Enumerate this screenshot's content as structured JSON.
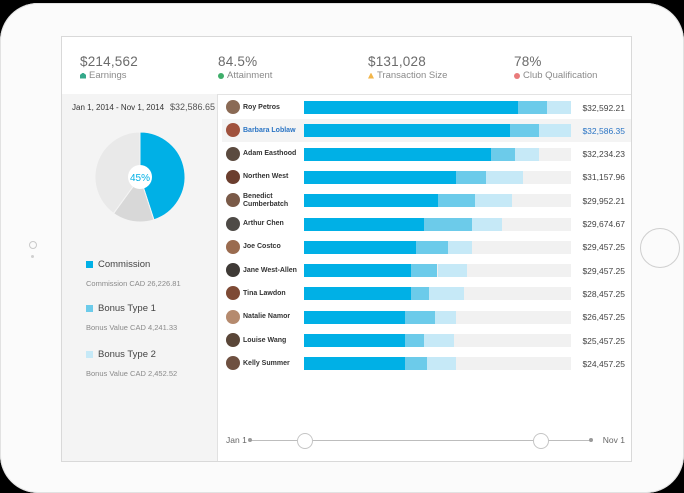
{
  "kpis": [
    {
      "value": "$214,562",
      "label": "Earnings",
      "icon": "earnings-icon",
      "color": "#34a88a"
    },
    {
      "value": "84.5%",
      "label": "Attainment",
      "icon": "attainment-icon",
      "color": "#3fae6a"
    },
    {
      "value": "$131,028",
      "label": "Transaction Size",
      "icon": "transaction-icon",
      "color": "#f2b64a"
    },
    {
      "value": "78%",
      "label": "Club Qualification",
      "icon": "club-icon",
      "color": "#e97b7b"
    }
  ],
  "left": {
    "date_range": "Jan 1, 2014 - Nov 1, 2014",
    "total": "$32,586.65",
    "donut_label": "45%",
    "donut_fractions": [
      0.45,
      0.15,
      0.4
    ],
    "legend": [
      {
        "name": "Commission",
        "detail": "Commission CAD 26,226.81",
        "color": "#00b0e6"
      },
      {
        "name": "Bonus Type 1",
        "detail": "Bonus Value CAD 4,241.33",
        "color": "#6ccbea"
      },
      {
        "name": "Bonus Type 2",
        "detail": "Bonus Value CAD 2,452.52",
        "color": "#c6e9f7"
      }
    ]
  },
  "people": [
    {
      "name": "Roy Petros",
      "amount": "$32,592.21",
      "segments": [
        80,
        11,
        9
      ]
    },
    {
      "name": "Barbara Loblaw",
      "amount": "$32,586.35",
      "segments": [
        77,
        11,
        12
      ],
      "selected": true
    },
    {
      "name": "Adam Easthood",
      "amount": "$32,234.23",
      "segments": [
        70,
        9,
        9
      ]
    },
    {
      "name": "Northen West",
      "amount": "$31,157.96",
      "segments": [
        57,
        11,
        14
      ]
    },
    {
      "name": "Benedict Cumberbatch",
      "amount": "$29,952.21",
      "segments": [
        50,
        14,
        14
      ]
    },
    {
      "name": "Arthur Chen",
      "amount": "$29,674.67",
      "segments": [
        45,
        18,
        11
      ]
    },
    {
      "name": "Joe Costco",
      "amount": "$29,457.25",
      "segments": [
        42,
        12,
        9
      ]
    },
    {
      "name": "Jane West-Allen",
      "amount": "$29,457.25",
      "segments": [
        40,
        10,
        11
      ]
    },
    {
      "name": "Tina Lawdon",
      "amount": "$28,457.25",
      "segments": [
        40,
        7,
        13
      ]
    },
    {
      "name": "Natalie Namor",
      "amount": "$26,457.25",
      "segments": [
        38,
        11,
        8
      ]
    },
    {
      "name": "Louise Wang",
      "amount": "$25,457.25",
      "segments": [
        38,
        7,
        11
      ]
    },
    {
      "name": "Kelly Summer",
      "amount": "$24,457.25",
      "segments": [
        38,
        8,
        11
      ]
    }
  ],
  "timeline": {
    "start": "Jan 1",
    "end": "Nov 1",
    "handle_positions": [
      0.16,
      0.85
    ]
  }
}
